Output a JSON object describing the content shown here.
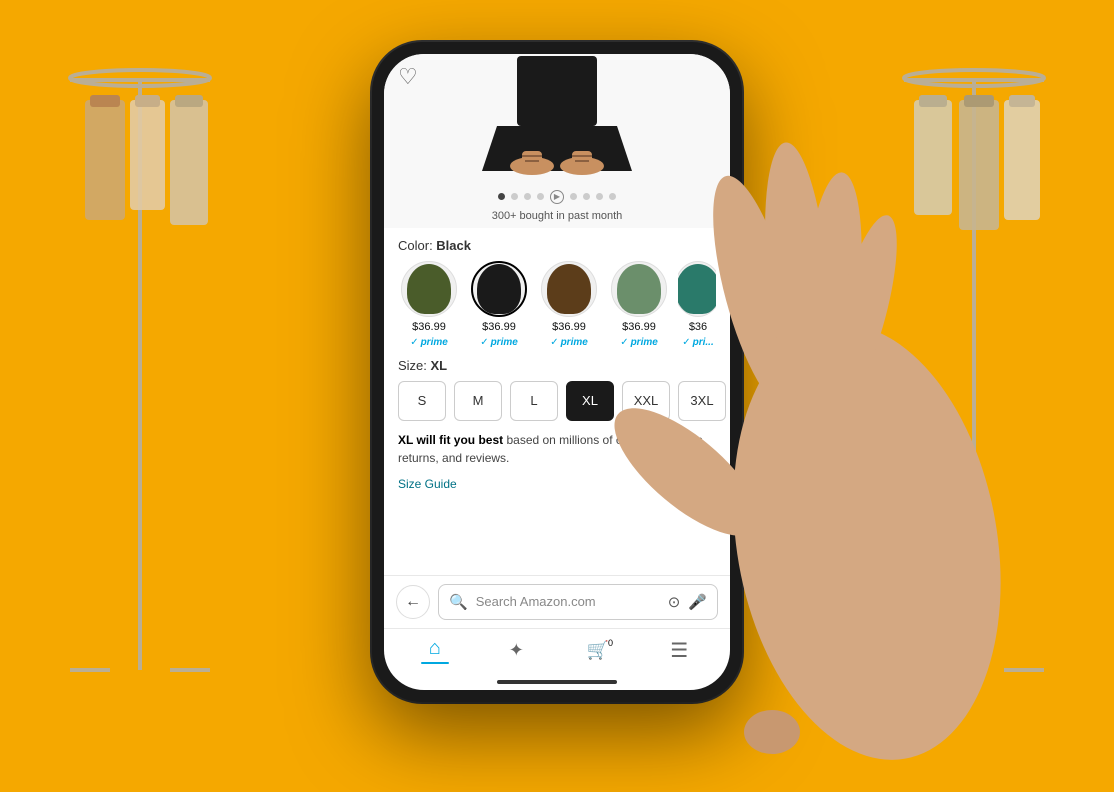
{
  "background_color": "#F5A800",
  "product": {
    "bought_badge": "300+ bought in past month",
    "color_label": "Color:",
    "color_selected": "Black",
    "colors": [
      {
        "name": "olive",
        "hex": "#4a5c2a",
        "price": "$36.99",
        "prime": true
      },
      {
        "name": "black",
        "hex": "#1a1a1a",
        "price": "$36.99",
        "prime": true,
        "selected": true
      },
      {
        "name": "brown",
        "hex": "#5c3d1a",
        "price": "$36.99",
        "prime": true
      },
      {
        "name": "sage",
        "hex": "#6b8f6b",
        "price": "$36.99",
        "prime": true
      },
      {
        "name": "teal",
        "hex": "#2a7a6a",
        "price": "$36",
        "prime": true
      }
    ],
    "size_label": "Size:",
    "size_selected": "XL",
    "sizes": [
      "S",
      "M",
      "L",
      "XL",
      "XXL",
      "3XL"
    ],
    "fit_rec": "XL will fit you best based on millions of customer orders, returns, and reviews.",
    "fit_rec_bold": "XL will fit you best",
    "size_guide": "Size Guide",
    "prime_label": "prime"
  },
  "search_bar": {
    "placeholder": "Search Amazon.com",
    "back_label": "←"
  },
  "nav": {
    "items": [
      {
        "id": "home",
        "icon": "⌂",
        "active": true
      },
      {
        "id": "discover",
        "icon": "✦",
        "active": false
      },
      {
        "id": "cart",
        "icon": "🛒",
        "active": false,
        "badge": "0"
      },
      {
        "id": "menu",
        "icon": "☰",
        "active": false
      }
    ]
  },
  "pagination": {
    "total": 9,
    "active_index": 0,
    "has_video": true,
    "video_index": 4
  }
}
